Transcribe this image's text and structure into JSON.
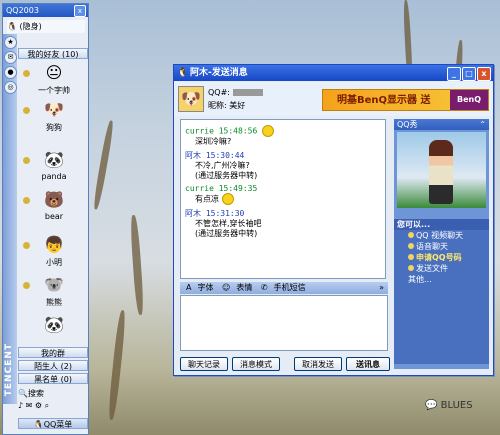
{
  "qq_panel": {
    "title": "QQ2003",
    "status": "(隐身)",
    "group_header": "我的好友 (10)",
    "friends": [
      {
        "name": "一个字帅",
        "icon": "face-icon"
      },
      {
        "name": "狗狗",
        "icon": "face-icon"
      },
      {
        "name": "panda",
        "icon": "panda-icon"
      },
      {
        "name": "bear",
        "icon": "bear-icon"
      },
      {
        "name": "小明",
        "icon": "face-icon"
      },
      {
        "name": "熊熊",
        "icon": "face-icon"
      },
      {
        "name": "",
        "icon": "panda-icon"
      }
    ],
    "groups": [
      "我的群",
      "陌生人 (2)",
      "黑名单 (0)"
    ],
    "search_label": "搜索",
    "menu_label": "QQ菜单",
    "brand": "TENCENT"
  },
  "chat": {
    "title": "阿木-发送消息",
    "qq_label": "QQ#:",
    "nickname_label": "昵称: 美好",
    "ad_text": "明基BenQ显示器 送",
    "ad_logo": "BenQ",
    "messages": [
      {
        "sender": "currie",
        "time": "15:48:56",
        "text": "深圳冷嘛?",
        "color": "green",
        "smile": true
      },
      {
        "sender": "阿木",
        "time": "15:30:44",
        "text": "不冷,广州冷嘛?",
        "text2": "(通过服务器中转)",
        "color": "blue"
      },
      {
        "sender": "currie",
        "time": "15:49:35",
        "text": "有点凉",
        "color": "green",
        "smile": true
      },
      {
        "sender": "阿木",
        "time": "15:31:30",
        "text": "不管怎样,穿长袖吧",
        "text2": "(通过服务器中转)",
        "color": "blue"
      }
    ],
    "toolbar": {
      "font": "字体",
      "emoticon": "表情",
      "sms": "手机短信"
    },
    "buttons": {
      "history": "聊天记录",
      "mode": "消息模式",
      "cancel": "取消发送",
      "send": "送讯息"
    },
    "side": {
      "show_title": "QQ秀",
      "options_title": "您可以...",
      "options": [
        "QQ 视频聊天",
        "语音聊天",
        "申请QQ号码",
        "发送文件",
        "其他..."
      ]
    }
  },
  "watermark": "BLUES"
}
